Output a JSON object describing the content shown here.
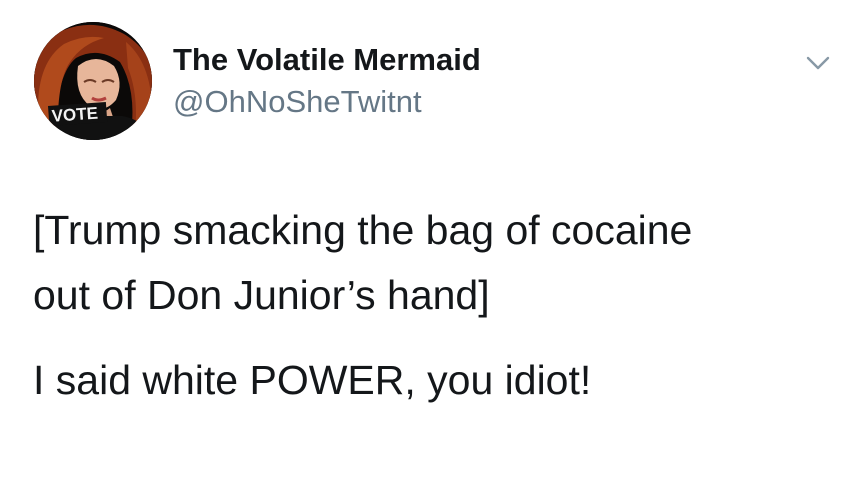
{
  "author": {
    "display_name": "The Volatile Mermaid",
    "handle": "@OhNoSheTwitnt",
    "avatar": {
      "icon": "profile-photo",
      "shirt_text": "VOTE"
    }
  },
  "menu": {
    "icon": "chevron-down-icon"
  },
  "tweet": {
    "lines": [
      "[Trump smacking the bag of cocaine",
      "out of Don Junior’s hand]",
      "I said white POWER, you idiot!"
    ]
  },
  "colors": {
    "text": "#14171a",
    "secondary_text": "#657786",
    "background": "#ffffff"
  }
}
